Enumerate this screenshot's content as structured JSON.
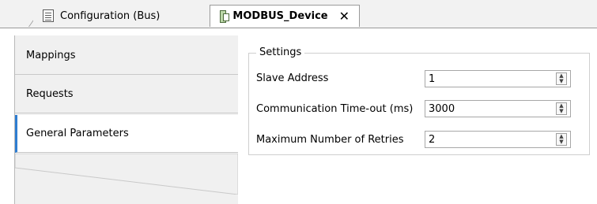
{
  "tabs": [
    {
      "label": "Configuration (Bus)",
      "icon": "doc-icon",
      "active": false
    },
    {
      "label": "MODBUS_Device",
      "icon": "device-icon",
      "active": true,
      "close_symbol": "✕"
    }
  ],
  "nav": {
    "items": [
      {
        "label": "Mappings",
        "active": false
      },
      {
        "label": "Requests",
        "active": false
      },
      {
        "label": "General Parameters",
        "active": true
      }
    ],
    "accent_color": "#2e7dd1"
  },
  "settings": {
    "title": "Settings",
    "slave_address": {
      "label": "Slave Address",
      "value": "1"
    },
    "timeout": {
      "label": "Communication Time-out (ms)",
      "value": "3000"
    },
    "retries": {
      "label": "Maximum Number of Retries",
      "value": "2"
    }
  }
}
